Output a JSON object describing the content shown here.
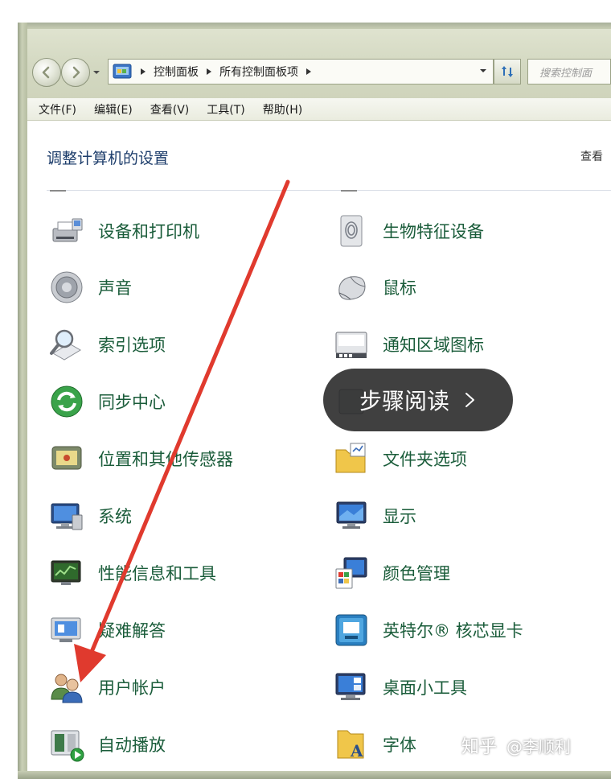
{
  "address_bar": {
    "breadcrumbs": [
      "控制面板",
      "所有控制面板项"
    ],
    "search_placeholder": "搜索控制面"
  },
  "menu": [
    "文件(F)",
    "编辑(E)",
    "查看(V)",
    "工具(T)",
    "帮助(H)"
  ],
  "content": {
    "title": "调整计算机的设置",
    "view_by": "查看"
  },
  "items_left": [
    {
      "label": "设备和打印机",
      "icon": "printer-icon"
    },
    {
      "label": "声音",
      "icon": "speaker-icon"
    },
    {
      "label": "索引选项",
      "icon": "magnifier-icon"
    },
    {
      "label": "同步中心",
      "icon": "sync-icon"
    },
    {
      "label": "位置和其他传感器",
      "icon": "sensor-icon"
    },
    {
      "label": "系统",
      "icon": "system-icon"
    },
    {
      "label": "性能信息和工具",
      "icon": "performance-icon"
    },
    {
      "label": "疑难解答",
      "icon": "troubleshoot-icon"
    },
    {
      "label": "用户帐户",
      "icon": "users-icon"
    },
    {
      "label": "自动播放",
      "icon": "autoplay-icon"
    }
  ],
  "items_right": [
    {
      "label": "生物特征设备",
      "icon": "fingerprint-icon"
    },
    {
      "label": "鼠标",
      "icon": "mouse-icon"
    },
    {
      "label": "通知区域图标",
      "icon": "taskbar-icon"
    },
    {
      "label": "",
      "icon": "hidden-icon"
    },
    {
      "label": "文件夹选项",
      "icon": "folder-options-icon"
    },
    {
      "label": "显示",
      "icon": "monitor-icon"
    },
    {
      "label": "颜色管理",
      "icon": "color-management-icon"
    },
    {
      "label": "英特尔® 核芯显卡",
      "icon": "intel-graphics-icon"
    },
    {
      "label": "桌面小工具",
      "icon": "gadgets-icon"
    },
    {
      "label": "字体",
      "icon": "fonts-icon"
    }
  ],
  "overlay": {
    "label": "步骤阅读"
  },
  "watermark": {
    "brand": "知乎",
    "user": "@李顺利"
  },
  "colors": {
    "link_green": "#1a5c3a",
    "title_blue": "#1d3d6b",
    "arrow_red": "#e03a2e",
    "pill_bg": "#262626"
  }
}
